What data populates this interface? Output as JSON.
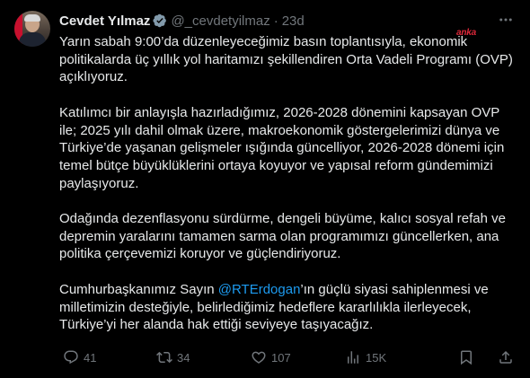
{
  "author": {
    "name": "Cevdet Yılmaz",
    "handle": "@_cevdetyilmaz",
    "separator": "·",
    "time": "23d"
  },
  "watermark": "anka",
  "tweet": {
    "p1": "Yarın sabah 9:00’da düzenleyeceğimiz basın toplantısıyla, ekonomik politikalarda üç yıllık yol haritamızı şekillendiren Orta Vadeli Programı (OVP) açıklıyoruz.",
    "p2": "Katılımcı bir anlayışla hazırladığımız, 2026-2028 dönemini kapsayan OVP ile; 2025 yılı dahil olmak üzere, makroekonomik göstergelerimizi dünya ve Türkiye’de yaşanan gelişmeler ışığında güncelliyor, 2026-2028 dönemi için temel bütçe büyüklüklerini ortaya koyuyor ve yapısal reform gündemimizi paylaşıyoruz.",
    "p3": "Odağında dezenflasyonu sürdürme, dengeli büyüme, kalıcı sosyal refah ve depremin yaralarını tamamen sarma olan programımızı güncellerken, ana politika çerçevemizi koruyor ve güçlendiriyoruz.",
    "p4_before": "Cumhurbaşkanımız Sayın ",
    "p4_mention": "@RTErdogan",
    "p4_after": "’ın güçlü siyasi sahiplenmesi ve milletimizin desteğiyle, belirlediğimiz hedeflere kararlılıkla ilerleyecek, Türkiye’yi her alanda hak ettiği seviyeye taşıyacağız."
  },
  "stats": {
    "replies": "41",
    "retweets": "34",
    "likes": "107",
    "views": "15K"
  },
  "colors": {
    "background": "#000000",
    "text": "#e7e9ea",
    "muted": "#71767b",
    "link": "#1d9bf0",
    "verified": "#829aab",
    "watermark": "#e0283a"
  },
  "icons": [
    "verified-badge-icon",
    "more-icon",
    "reply-icon",
    "retweet-icon",
    "like-icon",
    "views-icon",
    "bookmark-icon",
    "share-icon"
  ]
}
